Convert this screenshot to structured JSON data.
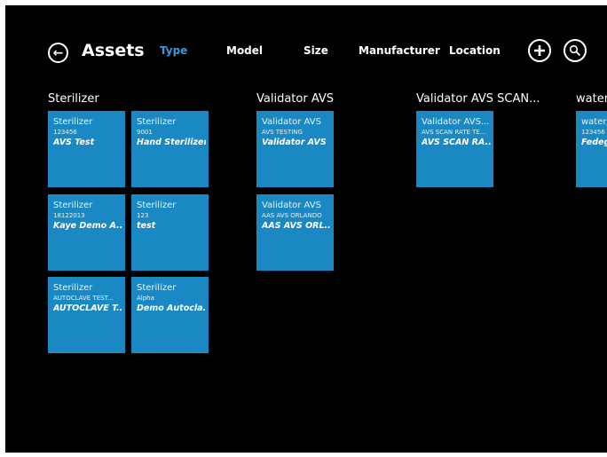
{
  "header": {
    "back_icon": "back-arrow-icon",
    "title": "Assets",
    "tabs": [
      {
        "label": "Type",
        "active": true
      },
      {
        "label": "Model",
        "active": false
      },
      {
        "label": "Size",
        "active": false
      },
      {
        "label": "Manufacturer",
        "active": false
      },
      {
        "label": "Location",
        "active": false
      }
    ],
    "add_icon": "plus-icon",
    "search_icon": "search-icon"
  },
  "colors": {
    "background": "#000000",
    "tile": "#1a88c2",
    "accent": "#3a9ad9"
  },
  "groups": [
    {
      "title": "Sterilizer",
      "tiles": [
        {
          "type": "Sterilizer",
          "model": "123456",
          "name": "AVS Test"
        },
        {
          "type": "Sterilizer",
          "model": "9001",
          "name": "Hand Sterilizer"
        },
        {
          "type": "Sterilizer",
          "model": "18122013",
          "name": "Kaye Demo A..."
        },
        {
          "type": "Sterilizer",
          "model": "123",
          "name": "test"
        },
        {
          "type": "Sterilizer",
          "model": "AUTOCLAVE TEST...",
          "name": "AUTOCLAVE T..."
        },
        {
          "type": "Sterilizer",
          "model": "Alpha",
          "name": "Demo Autocla..."
        }
      ]
    },
    {
      "title": "Validator AVS",
      "tiles": [
        {
          "type": "Validator AVS",
          "model": "AVS TESTING",
          "name": "Validator AVS"
        },
        {
          "type": "Validator AVS",
          "model": "AAS AVS ORLANDO",
          "name": "AAS AVS ORL..."
        }
      ]
    },
    {
      "title": "Validator AVS SCAN...",
      "tiles": [
        {
          "type": "Validator AVS...",
          "model": "AVS SCAN RATE TE...",
          "name": "AVS SCAN RA..."
        }
      ]
    },
    {
      "title": "water/",
      "tiles": [
        {
          "type": "water/",
          "model": "123456",
          "name": "Fedeg"
        }
      ]
    }
  ]
}
